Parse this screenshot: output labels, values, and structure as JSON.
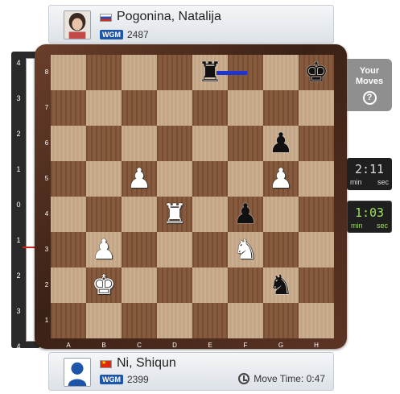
{
  "top_player": {
    "name": "Pogonina, Natalija",
    "flag": "russia-flag",
    "title": "WGM",
    "rating": "2487"
  },
  "bottom_player": {
    "name": "Ni, Shiqun",
    "flag": "china-flag",
    "title": "WGM",
    "rating": "2399",
    "move_time_label": "Move Time: 0:47"
  },
  "eval_bar": {
    "labels": [
      "4",
      "3",
      "2",
      "1",
      "0",
      "1",
      "2",
      "3",
      "4"
    ],
    "value": 0
  },
  "board": {
    "files": [
      "A",
      "B",
      "C",
      "D",
      "E",
      "F",
      "G",
      "H"
    ],
    "ranks": [
      "8",
      "7",
      "6",
      "5",
      "4",
      "3",
      "2",
      "1"
    ],
    "last_move": {
      "from": "f8",
      "to": "e8"
    },
    "pieces": [
      {
        "square": "e8",
        "color": "black",
        "type": "rook",
        "glyph": "♜",
        "icon": "black-rook-icon"
      },
      {
        "square": "h8",
        "color": "black",
        "type": "king",
        "glyph": "♚",
        "icon": "black-king-icon"
      },
      {
        "square": "g6",
        "color": "black",
        "type": "pawn",
        "glyph": "♟",
        "icon": "black-pawn-icon"
      },
      {
        "square": "c5",
        "color": "white",
        "type": "pawn",
        "glyph": "♟",
        "icon": "white-pawn-icon"
      },
      {
        "square": "g5",
        "color": "white",
        "type": "pawn",
        "glyph": "♟",
        "icon": "white-pawn-icon"
      },
      {
        "square": "d4",
        "color": "white",
        "type": "rook",
        "glyph": "♜",
        "icon": "white-rook-icon"
      },
      {
        "square": "f4",
        "color": "black",
        "type": "pawn",
        "glyph": "♟",
        "icon": "black-pawn-icon"
      },
      {
        "square": "b3",
        "color": "white",
        "type": "pawn",
        "glyph": "♟",
        "icon": "white-pawn-icon"
      },
      {
        "square": "f3",
        "color": "white",
        "type": "knight",
        "glyph": "♞",
        "icon": "white-knight-icon"
      },
      {
        "square": "b2",
        "color": "white",
        "type": "king",
        "glyph": "♚",
        "icon": "white-king-icon"
      },
      {
        "square": "g2",
        "color": "black",
        "type": "knight",
        "glyph": "♞",
        "icon": "black-knight-icon"
      }
    ]
  },
  "your_moves": {
    "label": "Your Moves",
    "help_glyph": "?"
  },
  "clocks": {
    "opponent": {
      "time": "2:11",
      "unit_min": "min",
      "unit_sec": "sec"
    },
    "player": {
      "time": "1:03",
      "unit_min": "min",
      "unit_sec": "sec"
    }
  },
  "colors": {
    "light_square": "#c9ab8b",
    "dark_square": "#815537",
    "last_move_arrow": "#1f35d0",
    "title_badge": "#1d55a8",
    "active_clock_text": "#9fe05a"
  }
}
